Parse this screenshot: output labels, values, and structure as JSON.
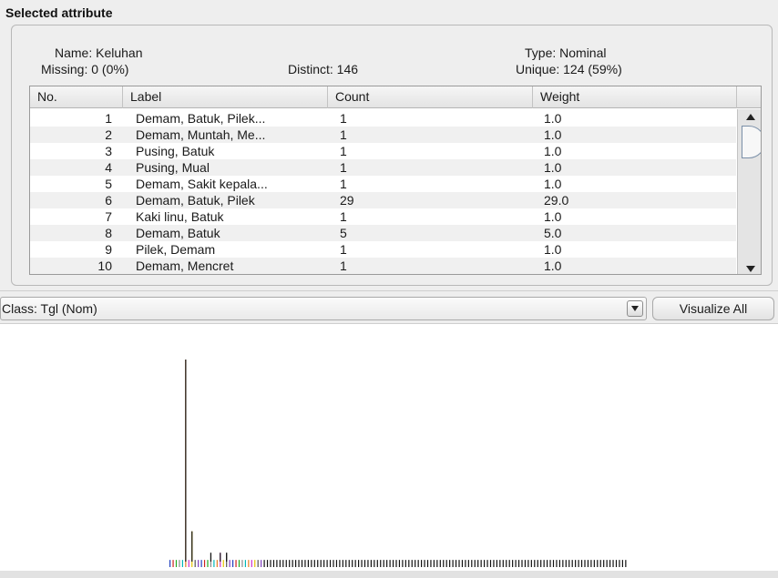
{
  "panel": {
    "title": "Selected attribute",
    "name_label": "Name: Keluhan",
    "missing_label": "Missing: 0 (0%)",
    "distinct_label": "Distinct: 146",
    "type_label": "Type: Nominal",
    "unique_label": "Unique: 124 (59%)"
  },
  "table": {
    "columns": [
      "No.",
      "Label",
      "Count",
      "Weight"
    ],
    "rows": [
      {
        "no": "1",
        "label": "Demam, Batuk, Pilek...",
        "count": "1",
        "weight": "1.0"
      },
      {
        "no": "2",
        "label": "Demam, Muntah, Me...",
        "count": "1",
        "weight": "1.0"
      },
      {
        "no": "3",
        "label": "Pusing, Batuk",
        "count": "1",
        "weight": "1.0"
      },
      {
        "no": "4",
        "label": "Pusing, Mual",
        "count": "1",
        "weight": "1.0"
      },
      {
        "no": "5",
        "label": "Demam, Sakit kepala...",
        "count": "1",
        "weight": "1.0"
      },
      {
        "no": "6",
        "label": "Demam, Batuk, Pilek",
        "count": "29",
        "weight": "29.0"
      },
      {
        "no": "7",
        "label": "Kaki linu, Batuk",
        "count": "1",
        "weight": "1.0"
      },
      {
        "no": "8",
        "label": "Demam, Batuk",
        "count": "5",
        "weight": "5.0"
      },
      {
        "no": "9",
        "label": "Pilek, Demam",
        "count": "1",
        "weight": "1.0"
      },
      {
        "no": "10",
        "label": "Demam, Mencret",
        "count": "1",
        "weight": "1.0"
      }
    ]
  },
  "class_selector": {
    "value": "Class: Tgl (Nom)",
    "arrow_icon": "chevron-down-icon"
  },
  "visualize_button": {
    "label": "Visualize All"
  },
  "chart_data": {
    "type": "bar",
    "title": "",
    "xlabel": "",
    "ylabel": "",
    "ylim": [
      0,
      29
    ],
    "x": [
      1,
      2,
      3,
      4,
      5,
      6,
      7,
      8,
      9,
      10,
      11,
      12,
      13,
      14,
      15,
      16,
      17,
      18,
      19,
      20,
      21,
      22,
      23,
      24,
      25,
      26,
      27,
      28,
      29,
      30,
      31,
      32,
      33,
      34,
      35,
      36,
      37,
      38,
      39,
      40,
      41,
      42,
      43,
      44,
      45,
      46,
      47,
      48,
      49,
      50,
      51,
      52,
      53,
      54,
      55,
      56,
      57,
      58,
      59,
      60,
      61,
      62,
      63,
      64,
      65,
      66,
      67,
      68,
      69,
      70,
      71,
      72,
      73,
      74,
      75,
      76,
      77,
      78,
      79,
      80,
      81,
      82,
      83,
      84,
      85,
      86,
      87,
      88,
      89,
      90,
      91,
      92,
      93,
      94,
      95,
      96,
      97,
      98,
      99,
      100,
      101,
      102,
      103,
      104,
      105,
      106,
      107,
      108,
      109,
      110,
      111,
      112,
      113,
      114,
      115,
      116,
      117,
      118,
      119,
      120,
      121,
      122,
      123,
      124,
      125,
      126,
      127,
      128,
      129,
      130,
      131,
      132,
      133,
      134,
      135,
      136,
      137,
      138,
      139,
      140,
      141,
      142,
      143,
      144,
      145,
      146
    ],
    "values": [
      1,
      1,
      1,
      1,
      1,
      29,
      1,
      5,
      1,
      1,
      1,
      1,
      1,
      2,
      1,
      1,
      2,
      1,
      2,
      1,
      1,
      1,
      1,
      1,
      1,
      1,
      1,
      1,
      1,
      1,
      1,
      1,
      1,
      1,
      1,
      1,
      1,
      1,
      1,
      1,
      1,
      1,
      1,
      1,
      1,
      1,
      1,
      1,
      1,
      1,
      1,
      1,
      1,
      1,
      1,
      1,
      1,
      1,
      1,
      1,
      1,
      1,
      1,
      1,
      1,
      1,
      1,
      1,
      1,
      1,
      1,
      1,
      1,
      1,
      1,
      1,
      1,
      1,
      1,
      1,
      1,
      1,
      1,
      1,
      1,
      1,
      1,
      1,
      1,
      1,
      1,
      1,
      1,
      1,
      1,
      1,
      1,
      1,
      1,
      1,
      1,
      1,
      1,
      1,
      1,
      1,
      1,
      1,
      1,
      1,
      1,
      1,
      1,
      1,
      1,
      1,
      1,
      1,
      1,
      1,
      1,
      1,
      1,
      1,
      1,
      1,
      1,
      1,
      1,
      1,
      1,
      1,
      1,
      1,
      1,
      1,
      1,
      1,
      1,
      1,
      1,
      1,
      1,
      1,
      1,
      1
    ],
    "class_colors": [
      "#1f3fbf",
      "#cc2222",
      "#22aa22",
      "#888888",
      "#00b8b8",
      "#e67e22",
      "#cc33cc",
      "#e6c200",
      "#555555",
      "#7f3fbf"
    ]
  }
}
